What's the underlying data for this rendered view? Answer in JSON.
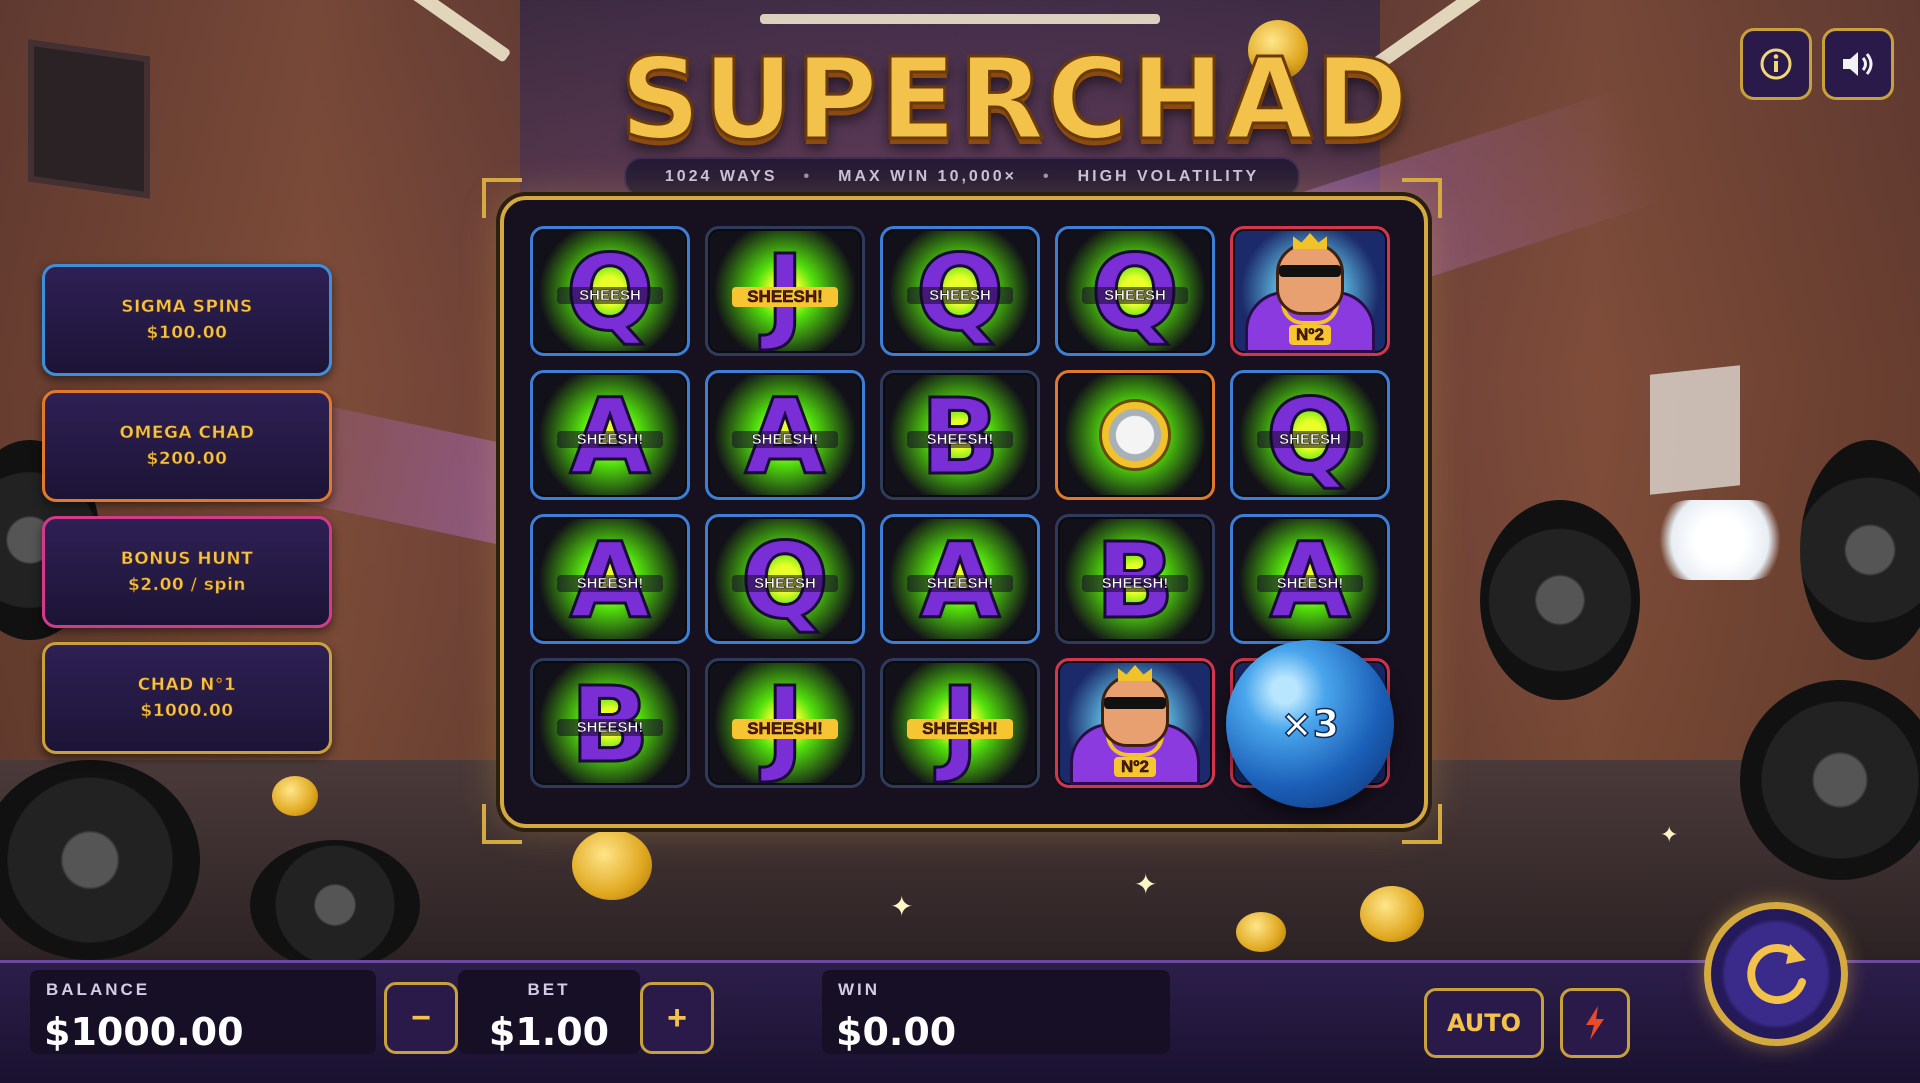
{
  "game": {
    "title": "SUPERCHAD",
    "features": [
      "1024 WAYS",
      "MAX WIN 10,000×",
      "HIGH VOLATILITY"
    ],
    "separator": "•"
  },
  "top_buttons": {
    "info_icon": "info-icon",
    "sound_icon": "speaker-icon"
  },
  "bonus_buys": [
    {
      "name": "SIGMA SPINS",
      "price": "$100.00",
      "border": "#3f8fd8"
    },
    {
      "name": "OMEGA CHAD",
      "price": "$200.00",
      "border": "#e07a2a"
    },
    {
      "name": "BONUS HUNT",
      "price": "$2.00 / spin",
      "border": "#d43a8a"
    },
    {
      "name": "CHAD N°1",
      "price": "$1000.00",
      "border": "#c9a13a"
    }
  ],
  "reels": {
    "rows": [
      [
        {
          "symbol": "Q",
          "tag": "SHEESH"
        },
        {
          "symbol": "J",
          "tag": "SHEESH!"
        },
        {
          "symbol": "Q",
          "tag": "SHEESH"
        },
        {
          "symbol": "Q",
          "tag": "SHEESH"
        },
        {
          "symbol": "CHAD",
          "tag": "Nº2"
        }
      ],
      [
        {
          "symbol": "A",
          "tag": "SHEESH!"
        },
        {
          "symbol": "A",
          "tag": "SHEESH!"
        },
        {
          "symbol": "B",
          "tag": "SHEESH!"
        },
        {
          "symbol": "WATCH",
          "tag": ""
        },
        {
          "symbol": "Q",
          "tag": "SHEESH"
        }
      ],
      [
        {
          "symbol": "A",
          "tag": "SHEESH!"
        },
        {
          "symbol": "Q",
          "tag": "SHEESH"
        },
        {
          "symbol": "A",
          "tag": "SHEESH!"
        },
        {
          "symbol": "B",
          "tag": "SHEESH!"
        },
        {
          "symbol": "A",
          "tag": "SHEESH!"
        }
      ],
      [
        {
          "symbol": "B",
          "tag": "SHEESH!"
        },
        {
          "symbol": "J",
          "tag": "SHEESH!"
        },
        {
          "symbol": "J",
          "tag": "SHEESH!"
        },
        {
          "symbol": "CHAD",
          "tag": "Nº2"
        },
        {
          "symbol": "ORB",
          "tag": ""
        }
      ]
    ],
    "multiplier": "×3"
  },
  "bottom": {
    "balance_label": "BALANCE",
    "balance_value": "$1000.00",
    "minus_label": "−",
    "bet_label": "BET",
    "bet_value": "$1.00",
    "plus_label": "+",
    "win_label": "WIN",
    "win_value": "$0.00",
    "auto_label": "AUTO",
    "turbo_icon": "lightning-icon",
    "spin_icon": "spin-arrow-icon"
  },
  "colors": {
    "gold": "#d4aa40",
    "title_gold": "#f3c24a",
    "panel_bg": "#160f26",
    "bar_bg": "#2c1e4a"
  }
}
